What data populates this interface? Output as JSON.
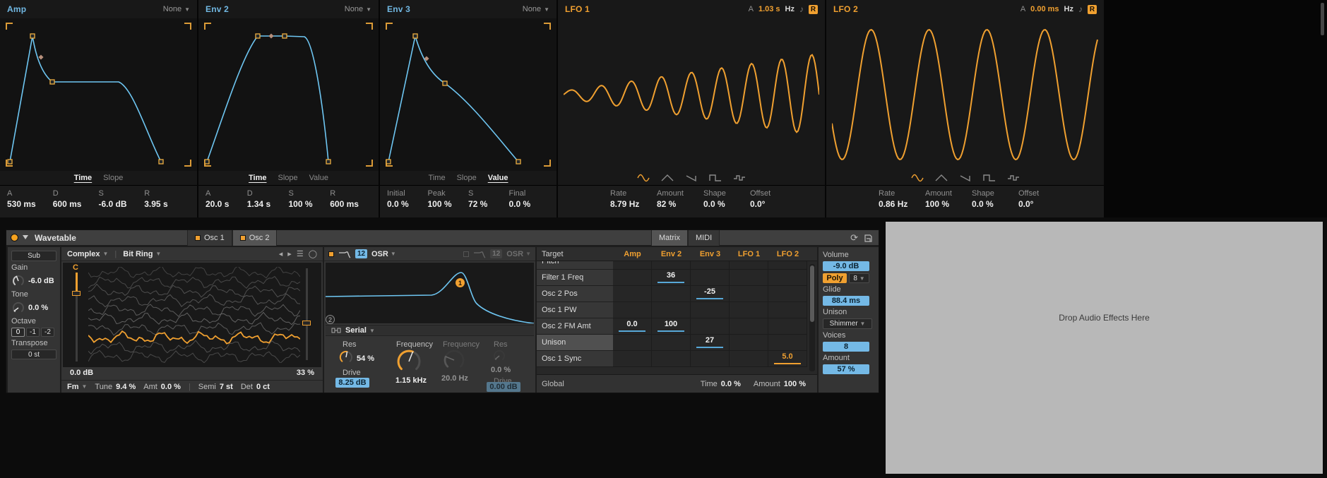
{
  "envelopes": [
    {
      "title": "Amp",
      "mod_source": "None",
      "tabs": [
        "Time",
        "Slope"
      ],
      "params": [
        {
          "label": "A",
          "value": "530 ms"
        },
        {
          "label": "D",
          "value": "600 ms"
        },
        {
          "label": "S",
          "value": "-6.0 dB"
        },
        {
          "label": "R",
          "value": "3.95 s"
        }
      ]
    },
    {
      "title": "Env 2",
      "mod_source": "None",
      "tabs": [
        "Time",
        "Slope",
        "Value"
      ],
      "params": [
        {
          "label": "A",
          "value": "20.0 s"
        },
        {
          "label": "D",
          "value": "1.34 s"
        },
        {
          "label": "S",
          "value": "100 %"
        },
        {
          "label": "R",
          "value": "600 ms"
        }
      ]
    },
    {
      "title": "Env 3",
      "mod_source": "None",
      "tabs": [
        "Time",
        "Slope",
        "Value"
      ],
      "params": [
        {
          "label": "Initial",
          "value": "0.0 %"
        },
        {
          "label": "Peak",
          "value": "100 %"
        },
        {
          "label": "S",
          "value": "72 %"
        },
        {
          "label": "Final",
          "value": "0.0 %"
        }
      ]
    }
  ],
  "lfos": [
    {
      "title": "LFO 1",
      "attack_label": "A",
      "attack_value": "1.03 s",
      "rate_mode": "Hz",
      "note_icon": "eighth-note",
      "retrigger_label": "R",
      "shapes": [
        "sine",
        "triangle",
        "saw",
        "square",
        "sample-hold"
      ],
      "params": [
        {
          "label": "Rate",
          "value": "8.79 Hz"
        },
        {
          "label": "Amount",
          "value": "82 %"
        },
        {
          "label": "Shape",
          "value": "0.0 %"
        },
        {
          "label": "Offset",
          "value": "0.0°"
        }
      ]
    },
    {
      "title": "LFO 2",
      "attack_label": "A",
      "attack_value": "0.00 ms",
      "rate_mode": "Hz",
      "note_icon": "eighth-note",
      "retrigger_label": "R",
      "shapes": [
        "sine",
        "triangle",
        "saw",
        "square",
        "sample-hold"
      ],
      "params": [
        {
          "label": "Rate",
          "value": "0.86 Hz"
        },
        {
          "label": "Amount",
          "value": "100 %"
        },
        {
          "label": "Shape",
          "value": "0.0 %"
        },
        {
          "label": "Offset",
          "value": "0.0°"
        }
      ]
    }
  ],
  "device": {
    "title": "Wavetable",
    "osc_tabs": [
      {
        "label": "Osc 1",
        "selected": false
      },
      {
        "label": "Osc 2",
        "selected": true
      }
    ],
    "view_tabs": [
      {
        "label": "Matrix",
        "selected": true
      },
      {
        "label": "MIDI",
        "selected": false
      }
    ],
    "sub": {
      "button": "Sub",
      "gain_label": "Gain",
      "gain_value": "-6.0 dB",
      "tone_label": "Tone",
      "tone_value": "0.0 %",
      "octave_label": "Octave",
      "octave_options": [
        "0",
        "-1",
        "-2"
      ],
      "transpose_label": "Transpose",
      "transpose_value": "0 st"
    },
    "osc2": {
      "category": "Complex",
      "wavetable": "Bit Ring",
      "note_label": "C",
      "gain": "0.0 dB",
      "position": "33 %",
      "mod_mode": "Fm",
      "tune_label": "Tune",
      "tune": "9.4 %",
      "amt_label": "Amt",
      "amt": "0.0 %",
      "semi_label": "Semi",
      "semi": "7 st",
      "det_label": "Det",
      "det": "0 ct"
    },
    "filter": {
      "f1_slope": "12",
      "f1_mode": "OSR",
      "f2_slope": "12",
      "f2_mode": "OSR",
      "marker1": "1",
      "marker2": "2",
      "routing": "Serial",
      "res_label": "Res",
      "res": "54 %",
      "drive1_label": "Drive",
      "drive1": "8.25 dB",
      "freq_label": "Frequency",
      "freq": "1.15 kHz",
      "f2_freq_label": "Frequency",
      "f2_res_label": "Res",
      "f2_freq": "20.0 Hz",
      "f2_res": "0.0 %",
      "drive2_label": "Drive",
      "drive2": "0.00 dB"
    },
    "matrix": {
      "target_header": "Target",
      "columns": [
        "Amp",
        "Env 2",
        "Env 3",
        "LFO 1",
        "LFO 2"
      ],
      "rows": [
        {
          "label": "Pitch",
          "cells": []
        },
        {
          "label": "Filter 1 Freq",
          "cells": [
            {
              "col": 1,
              "value": "36"
            }
          ]
        },
        {
          "label": "Osc 2 Pos",
          "cells": [
            {
              "col": 2,
              "value": "-25"
            }
          ]
        },
        {
          "label": "Osc 1 PW",
          "cells": []
        },
        {
          "label": "Osc 2 FM Amt",
          "cells": [
            {
              "col": 0,
              "value": "0.0"
            },
            {
              "col": 1,
              "value": "100"
            }
          ]
        },
        {
          "label": "Unison",
          "highlight": true,
          "cells": [
            {
              "col": 2,
              "value": "27"
            }
          ]
        },
        {
          "label": "Osc 1 Sync",
          "cells": [
            {
              "col": 4,
              "value": "5.0",
              "accent": "orange"
            }
          ]
        }
      ],
      "global_row": {
        "label": "Global",
        "time_label": "Time",
        "time": "0.0 %",
        "amount_label": "Amount",
        "amount": "100 %"
      }
    },
    "global_panel": {
      "volume_label": "Volume",
      "volume": "-9.0 dB",
      "poly_label": "Poly",
      "poly_voices": "8",
      "glide_label": "Glide",
      "glide": "88.4 ms",
      "unison_label": "Unison",
      "unison_mode": "Shimmer",
      "voices_label": "Voices",
      "voices": "8",
      "amount_label": "Amount",
      "amount": "57 %"
    }
  },
  "drop_area": {
    "text": "Drop Audio Effects Here"
  }
}
